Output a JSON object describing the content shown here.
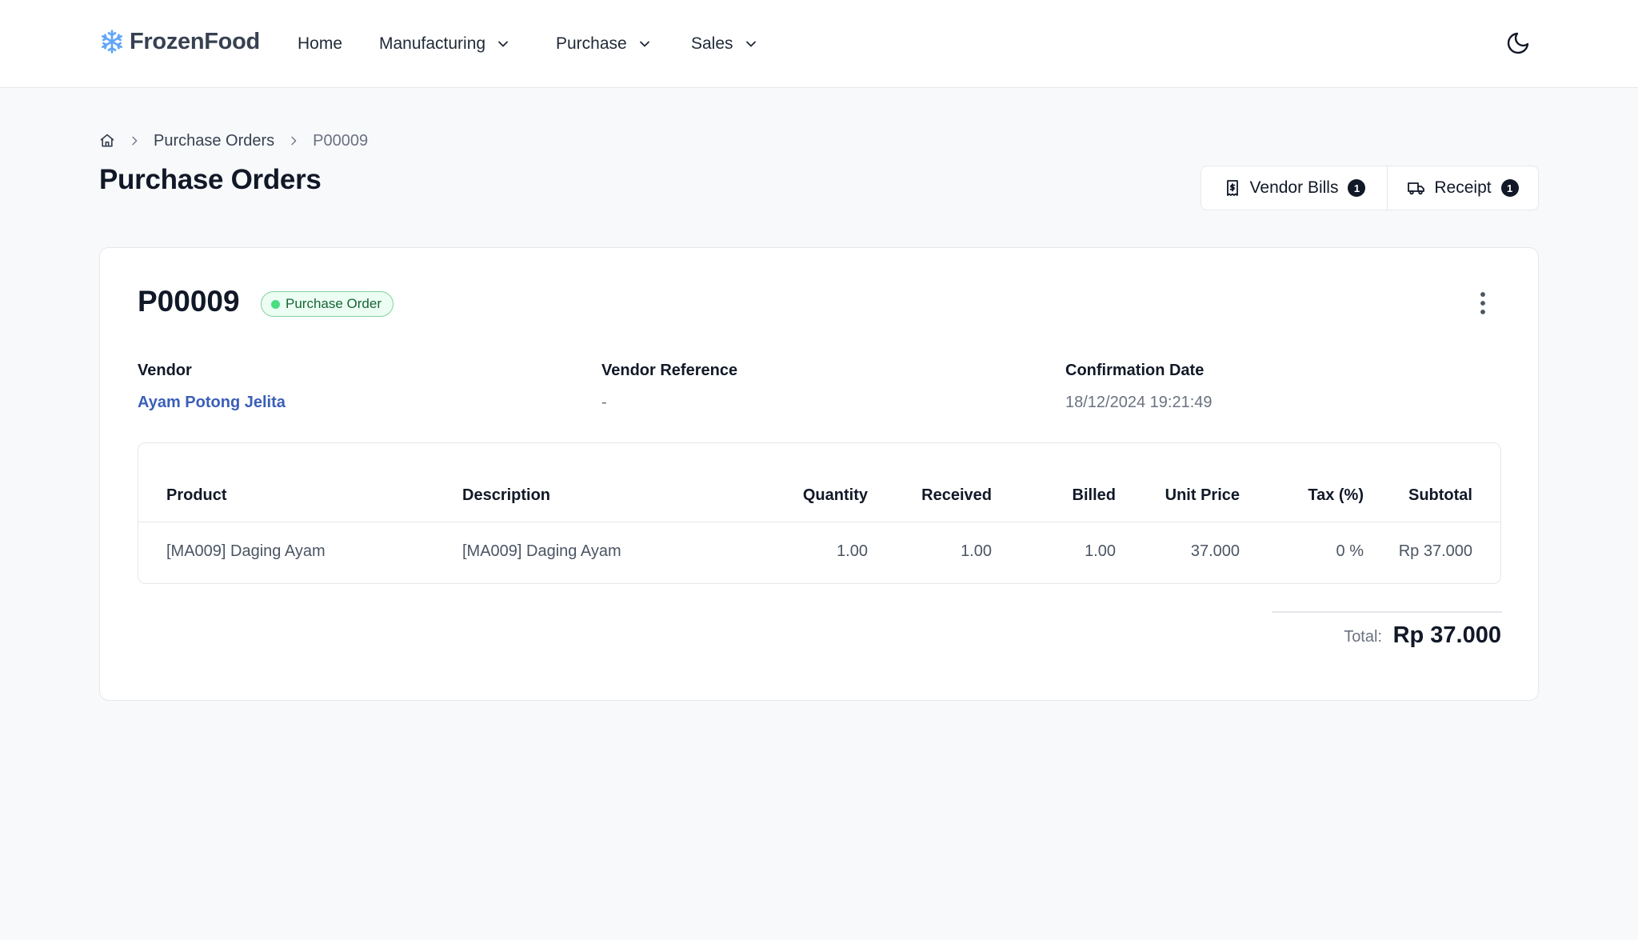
{
  "app": {
    "brand": "FrozenFood"
  },
  "nav": {
    "home": "Home",
    "manufacturing": "Manufacturing",
    "purchase": "Purchase",
    "sales": "Sales"
  },
  "breadcrumb": {
    "section": "Purchase Orders",
    "current": "P00009"
  },
  "page": {
    "title": "Purchase Orders"
  },
  "actions": {
    "vendor_bills": {
      "label": "Vendor Bills",
      "count": "1"
    },
    "receipt": {
      "label": "Receipt",
      "count": "1"
    }
  },
  "order": {
    "number": "P00009",
    "status": "Purchase Order",
    "vendor_label": "Vendor",
    "vendor_value": "Ayam Potong Jelita",
    "vendor_ref_label": "Vendor Reference",
    "vendor_ref_value": "-",
    "confirm_label": "Confirmation Date",
    "confirm_value": "18/12/2024 19:21:49"
  },
  "table": {
    "headers": [
      "Product",
      "Description",
      "Quantity",
      "Received",
      "Billed",
      "Unit Price",
      "Tax (%)",
      "Subtotal"
    ],
    "rows": [
      [
        "[MA009] Daging Ayam",
        "[MA009] Daging Ayam",
        "1.00",
        "1.00",
        "1.00",
        "37.000",
        "0 %",
        "Rp 37.000"
      ]
    ]
  },
  "totals": {
    "label": "Total:",
    "value": "Rp 37.000"
  },
  "colors": {
    "accent_link": "#3b5fb8",
    "status_green": "#4ade80",
    "brand_icon": "#60a5fa"
  }
}
